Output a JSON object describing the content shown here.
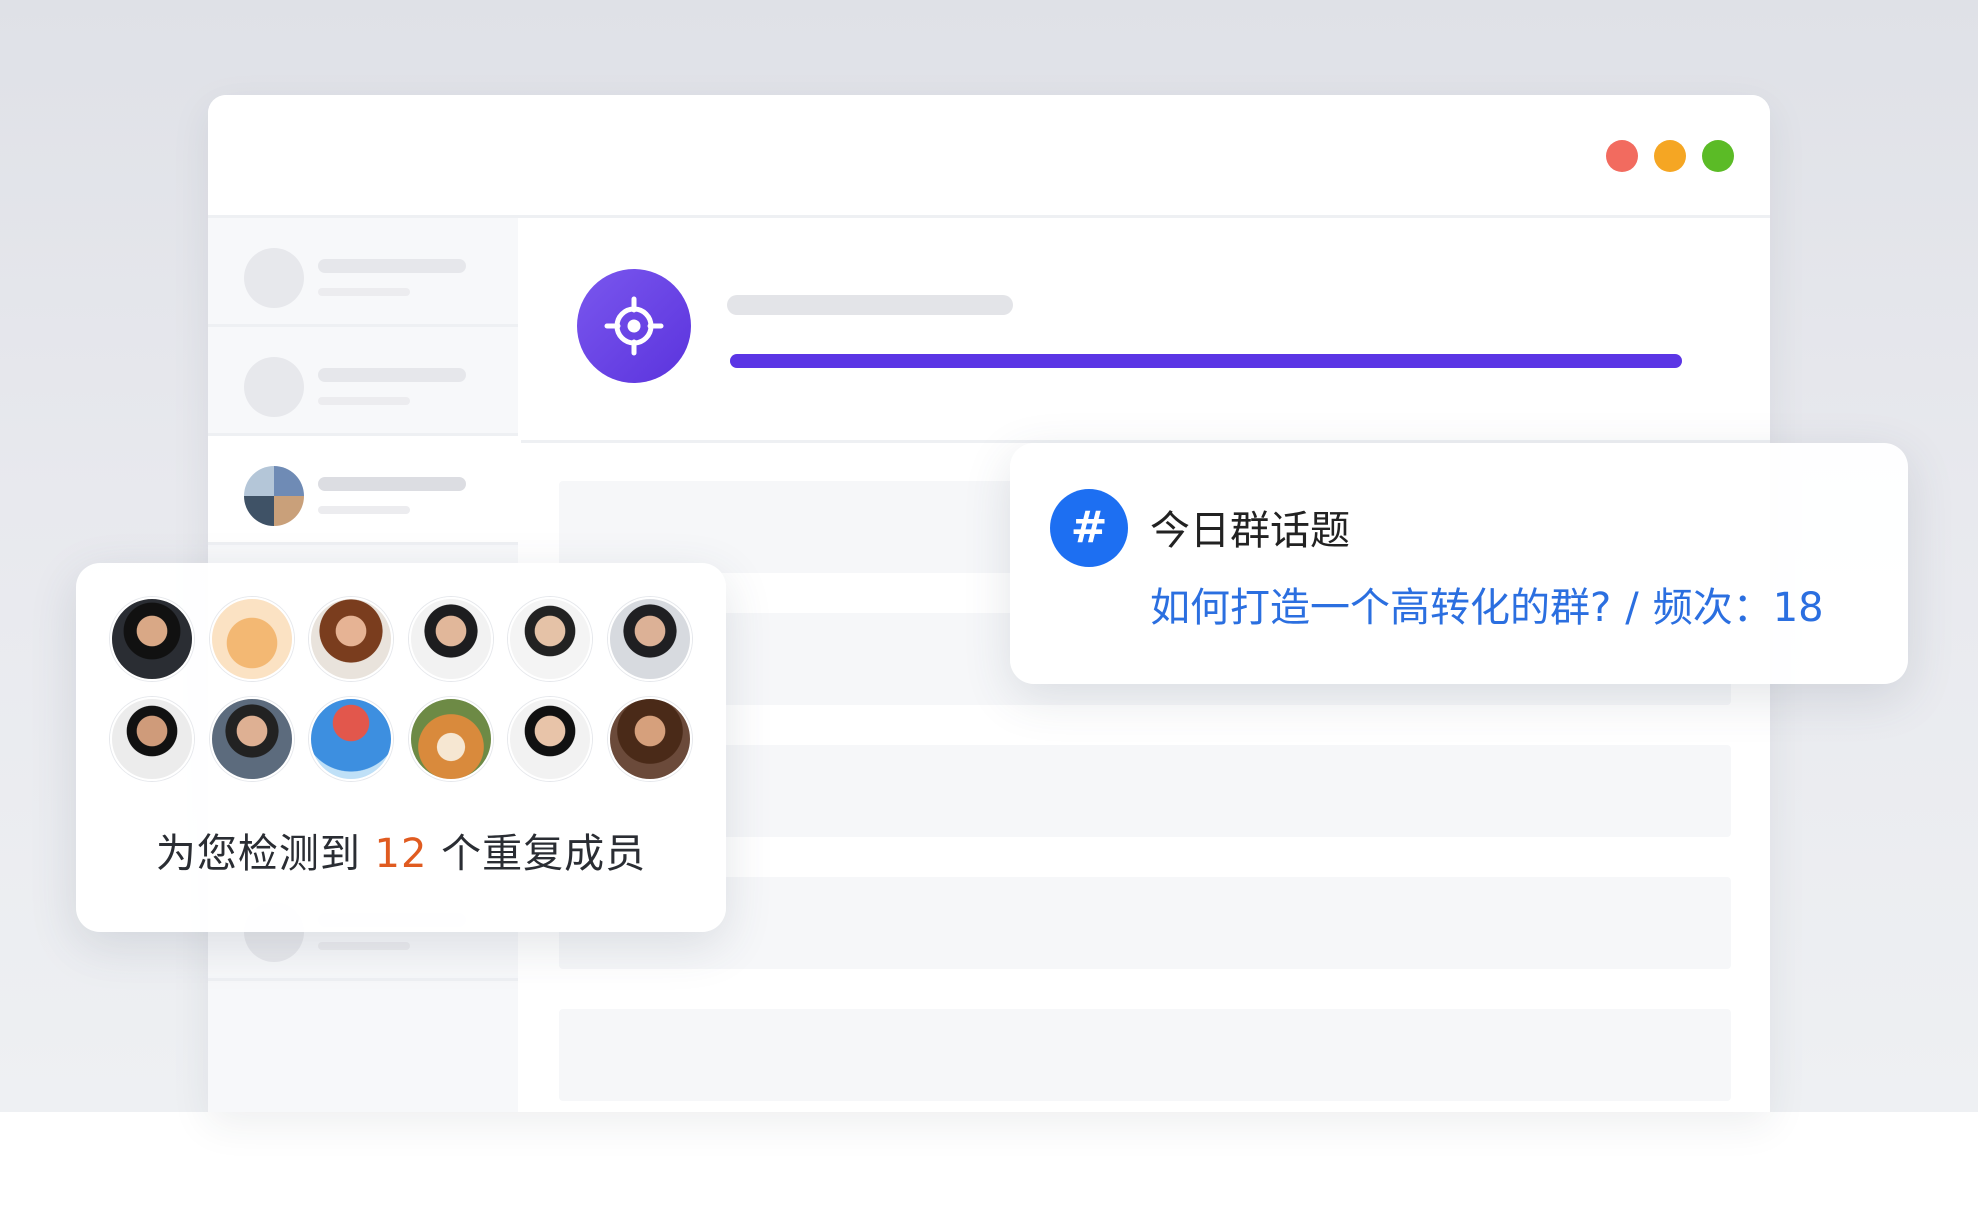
{
  "window": {
    "controls": [
      "close-dot",
      "minimize-dot",
      "maximize-dot"
    ],
    "colors": {
      "close": "#f26b5f",
      "minimize": "#f5a623",
      "maximize": "#5bbb26"
    }
  },
  "header": {
    "icon": "target-icon",
    "accent_color": "#5b35e5",
    "progress": 1.0
  },
  "members_card": {
    "text_before": "为您检测到",
    "count": "12",
    "text_after": "个重复成员",
    "count_color": "#e05b20",
    "avatars": [
      "person-avatar",
      "cat-avatar",
      "person-avatar",
      "person-avatar",
      "person-avatar",
      "person-avatar",
      "person-avatar",
      "person-avatar",
      "umbrella-avatar",
      "dog-avatar",
      "person-avatar",
      "person-avatar"
    ]
  },
  "topic_card": {
    "badge": "#",
    "title": "今日群话题",
    "question": "如何打造一个高转化的群?",
    "separator": "/",
    "frequency_label": "频次：",
    "frequency": "18",
    "accent_color": "#1d6ff2"
  }
}
